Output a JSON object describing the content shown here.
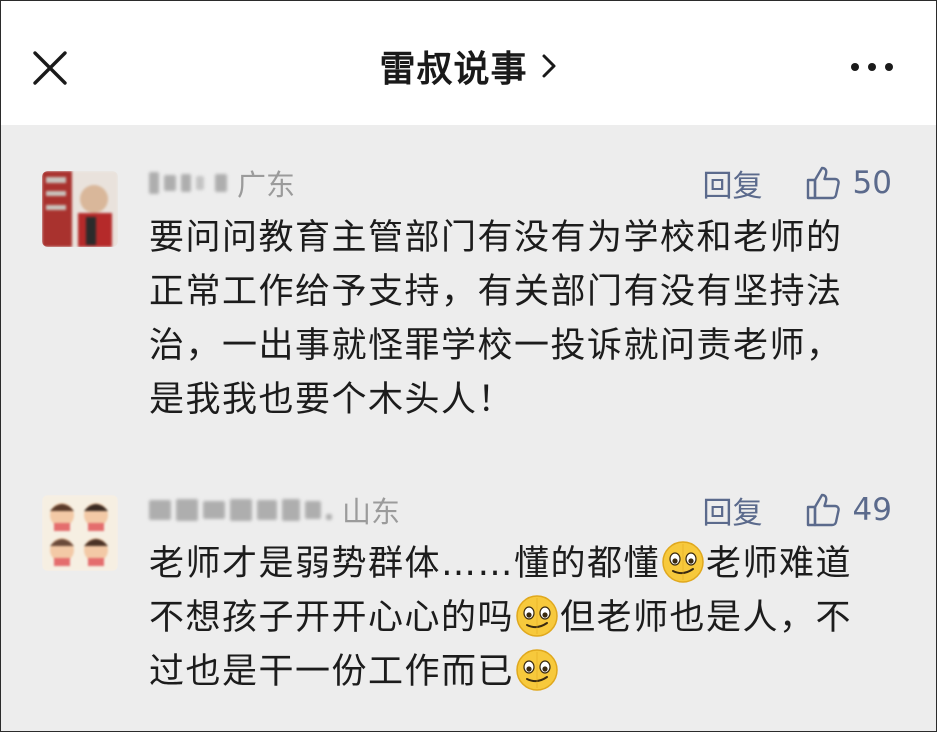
{
  "header": {
    "title": "雷叔说事",
    "close_icon": "close-icon",
    "more_icon": "more-icon"
  },
  "comments": [
    {
      "location": "广东",
      "reply_label": "回复",
      "like_count": "50",
      "lines": [
        "要问问教育主管部门有没有为学校和老师的",
        "正常工作给予支持，有关部门有没有坚持法",
        "治，一出事就怪罪学校一投诉就问责老师，",
        "是我我也要个木头人！"
      ]
    },
    {
      "location": "山东",
      "reply_label": "回复",
      "like_count": "49",
      "line1_a": "老师才是弱势群体……懂的都懂",
      "line1_b": "老师难道",
      "line2_a": "不想孩子开开心心的吗",
      "line2_b": "但老师也是人，不",
      "line3_a": "过也是干一份工作而已",
      "emoji_name": "smirk-emoji"
    }
  ],
  "colors": {
    "accent": "#5b6a8c",
    "background": "#ededed",
    "header_bg": "#ffffff"
  }
}
